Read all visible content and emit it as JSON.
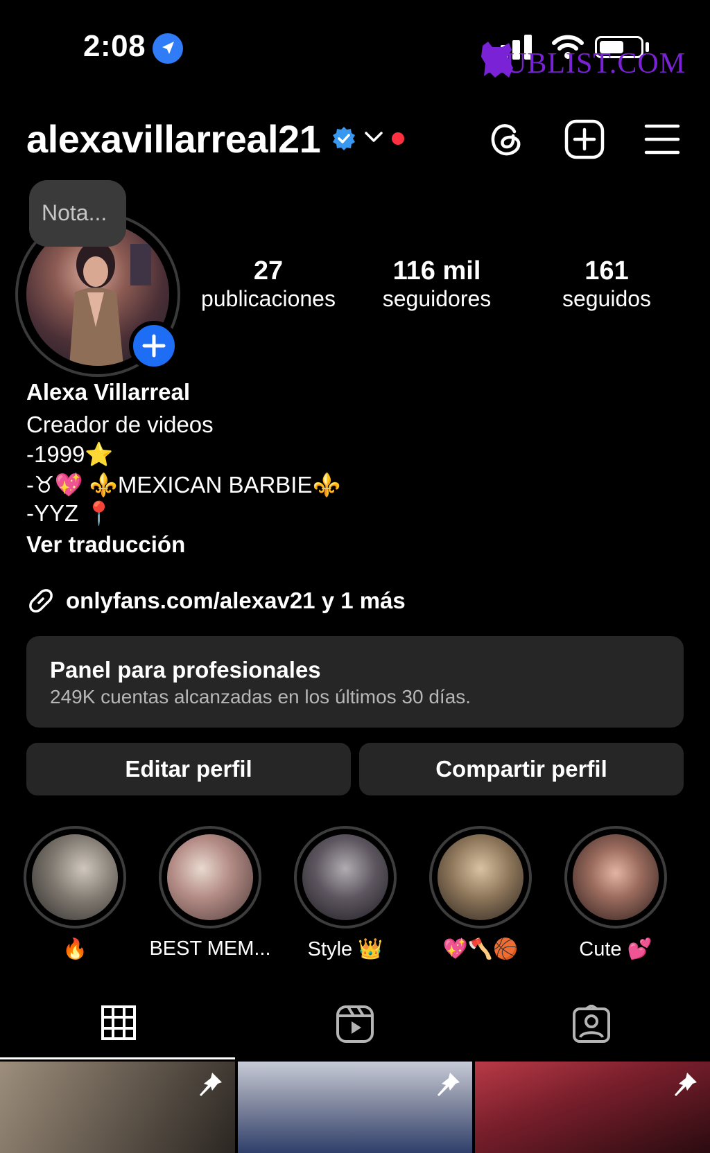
{
  "status_bar": {
    "time": "2:08",
    "watermark": "RUBLIST.COM"
  },
  "header": {
    "username": "alexavillarreal21"
  },
  "note": {
    "placeholder": "Nota..."
  },
  "stats": [
    {
      "value": "27",
      "label": "publicaciones"
    },
    {
      "value": "116 mil",
      "label": "seguidores"
    },
    {
      "value": "161",
      "label": "seguidos"
    }
  ],
  "bio": {
    "name": "Alexa Villarreal",
    "category": "Creador de videos",
    "lines": [
      "-1999⭐",
      "-♉💖 ⚜️MEXICAN BARBIE⚜️",
      "-YYZ 📍"
    ],
    "translate": "Ver traducción"
  },
  "link": {
    "text": "onlyfans.com/alexav21 y 1 más"
  },
  "dashboard": {
    "title": "Panel para profesionales",
    "subtitle": "249K cuentas alcanzadas en los últimos 30 días."
  },
  "actions": {
    "edit": "Editar perfil",
    "share": "Compartir perfil"
  },
  "highlights": [
    {
      "label": "🔥"
    },
    {
      "label": "BEST MEM..."
    },
    {
      "label": "Style 👑"
    },
    {
      "label": "💖🪓🏀"
    },
    {
      "label": "Cute 💕"
    }
  ],
  "tabs": [
    {
      "icon": "grid-icon",
      "active": true
    },
    {
      "icon": "reels-icon",
      "active": false
    },
    {
      "icon": "tagged-icon",
      "active": false
    }
  ],
  "colors": {
    "accent": "#1d6ef5",
    "surface": "#262626",
    "notification": "#ff3040",
    "watermark": "#7a22d6"
  }
}
